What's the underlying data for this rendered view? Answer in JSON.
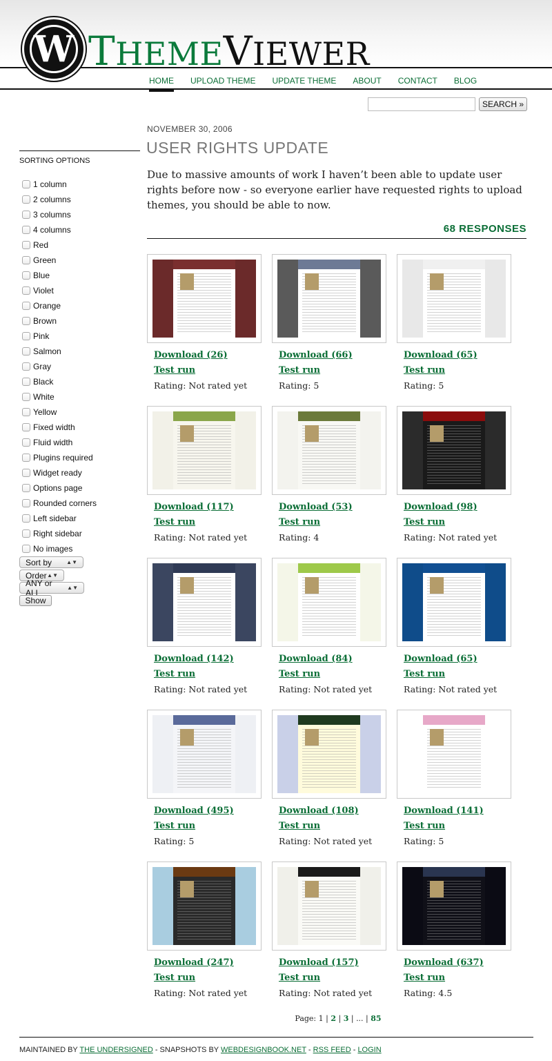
{
  "header": {
    "title_part1_cap": "T",
    "title_part1_rest": "HEME",
    "title_part2_cap": "V",
    "title_part2_rest": "IEWER",
    "logo_letter": "W"
  },
  "nav": [
    {
      "label": "HOME",
      "active": true
    },
    {
      "label": "UPLOAD THEME"
    },
    {
      "label": "UPDATE THEME"
    },
    {
      "label": "ABOUT"
    },
    {
      "label": "CONTACT"
    },
    {
      "label": "BLOG"
    }
  ],
  "search": {
    "value": "",
    "button_label": "SEARCH »"
  },
  "sidebar": {
    "title": "SORTING OPTIONS",
    "options": [
      "1 column",
      "2 columns",
      "3 columns",
      "4 columns",
      "Red",
      "Green",
      "Blue",
      "Violet",
      "Orange",
      "Brown",
      "Pink",
      "Salmon",
      "Gray",
      "Black",
      "White",
      "Yellow",
      "Fixed width",
      "Fluid width",
      "Plugins required",
      "Widget ready",
      "Options page",
      "Rounded corners",
      "Left sidebar",
      "Right sidebar",
      "No images"
    ],
    "sort_by": "Sort by",
    "order": "Order",
    "match": "ANY or ALL",
    "show_label": "Show"
  },
  "post": {
    "date": "NOVEMBER 30, 2006",
    "title": "USER RIGHTS UPDATE",
    "body": "Due to massive amounts of work I haven’t been able to update user rights before now - so everyone earlier have requested rights to upload themes, you should be able to now.",
    "responses": "68 RESPONSES"
  },
  "themes": [
    {
      "download": "Download (26)",
      "test": "Test run",
      "rating": "Rating: Not rated yet",
      "bg": "#6b2a2a",
      "page": "#ffffff",
      "head": "#7a2f2f"
    },
    {
      "download": "Download (66)",
      "test": "Test run",
      "rating": "Rating: 5",
      "bg": "#5a5a5a",
      "page": "#ffffff",
      "head": "#6d7a95"
    },
    {
      "download": "Download (65)",
      "test": "Test run",
      "rating": "Rating: 5",
      "bg": "#e8e8e8",
      "page": "#ffffff",
      "head": "#f0f0f0"
    },
    {
      "download": "Download (117)",
      "test": "Test run",
      "rating": "Rating: Not rated yet",
      "bg": "#f2f1e8",
      "page": "#f7f6ee",
      "head": "#8aa64a"
    },
    {
      "download": "Download (53)",
      "test": "Test run",
      "rating": "Rating: 4",
      "bg": "#f3f3ee",
      "page": "#f8f8f4",
      "head": "#6b7a3a"
    },
    {
      "download": "Download (98)",
      "test": "Test run",
      "rating": "Rating: Not rated yet",
      "bg": "#2b2b2b",
      "page": "#1a1a1a",
      "head": "#8b0c0c"
    },
    {
      "download": "Download (142)",
      "test": "Test run",
      "rating": "Rating: Not rated yet",
      "bg": "#3b4660",
      "page": "#ffffff",
      "head": "#2f3a55"
    },
    {
      "download": "Download (84)",
      "test": "Test run",
      "rating": "Rating: Not rated yet",
      "bg": "#f4f6e8",
      "page": "#ffffff",
      "head": "#9ec94a"
    },
    {
      "download": "Download (65)",
      "test": "Test run",
      "rating": "Rating: Not rated yet",
      "bg": "#0f4c8a",
      "page": "#ffffff",
      "head": "#114f92"
    },
    {
      "download": "Download (495)",
      "test": "Test run",
      "rating": "Rating: 5",
      "bg": "#eef0f4",
      "page": "#f4f5f8",
      "head": "#5a6a9a"
    },
    {
      "download": "Download (108)",
      "test": "Test run",
      "rating": "Rating: Not rated yet",
      "bg": "#c9d0e8",
      "page": "#fffbdc",
      "head": "#1f3a1f"
    },
    {
      "download": "Download (141)",
      "test": "Test run",
      "rating": "Rating: 5",
      "bg": "#ffffff",
      "page": "#ffffff",
      "head": "#e7a8c8"
    },
    {
      "download": "Download (247)",
      "test": "Test run",
      "rating": "Rating: Not rated yet",
      "bg": "#a9cde0",
      "page": "#2a2a2a",
      "head": "#6b3a12"
    },
    {
      "download": "Download (157)",
      "test": "Test run",
      "rating": "Rating: Not rated yet",
      "bg": "#f0f0ea",
      "page": "#fafaf6",
      "head": "#1a1a1a"
    },
    {
      "download": "Download (637)",
      "test": "Test run",
      "rating": "Rating: 4.5",
      "bg": "#0b0b14",
      "page": "#101018",
      "head": "#2a3550"
    }
  ],
  "pager": {
    "prefix": "Page:",
    "current": "1",
    "p2": "2",
    "p3": "3",
    "ellipsis": "...",
    "last": "85"
  },
  "footer": {
    "t1": "MAINTAINED BY ",
    "l1": "THE UNDERSIGNED",
    "t2": " - SNAPSHOTS BY ",
    "l2": "WEBDESIGNBOOK.NET",
    "t3": " - ",
    "l3": "RSS FEED",
    "t4": " - ",
    "l4": "LOGIN"
  }
}
